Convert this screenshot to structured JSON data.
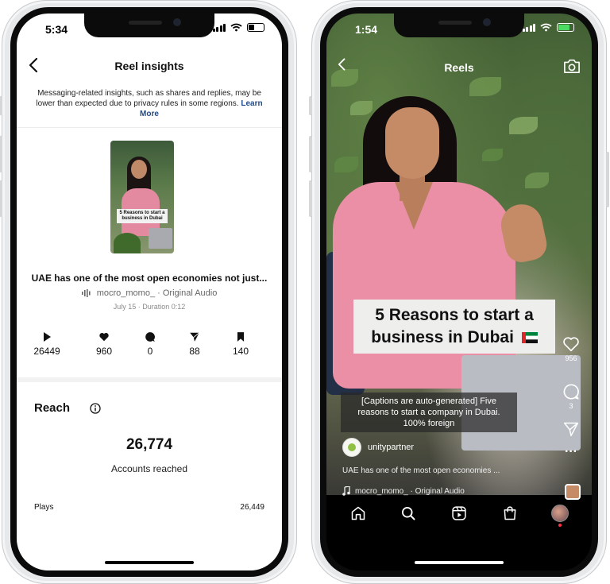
{
  "insights": {
    "status_time": "5:34",
    "header_title": "Reel insights",
    "notice_text": "Messaging-related insights, such as shares and replies, may be lower than expected due to privacy rules in some regions.",
    "notice_link": "Learn More",
    "thumbnail_caption": "5 Reasons to start a business in Dubai",
    "reel_caption": "UAE has one of the most open economies not just...",
    "audio": "mocro_momo_ · Original Audio",
    "meta": "July 15 · Duration 0:12",
    "stats": [
      {
        "icon": "play-icon",
        "value": "26449"
      },
      {
        "icon": "heart-icon",
        "value": "960"
      },
      {
        "icon": "comment-icon",
        "value": "0"
      },
      {
        "icon": "share-icon",
        "value": "88"
      },
      {
        "icon": "bookmark-icon",
        "value": "140"
      }
    ],
    "reach_title": "Reach",
    "accounts_reached_value": "26,774",
    "accounts_reached_label": "Accounts reached",
    "plays_label": "Plays",
    "plays_value": "26,449"
  },
  "reel": {
    "status_time": "1:54",
    "header_title": "Reels",
    "video_title_line1": "5 Reasons to start a",
    "video_title_line2": "business in Dubai",
    "like_count": "956",
    "comment_count": "3",
    "auto_caption": "[Captions are auto-generated] Five reasons to start a company in Dubai. 100% foreign",
    "username": "unitypartner",
    "caption": "UAE has one of the most open economies ...",
    "audio": "mocro_momo_ · Original Audio",
    "nav": [
      "home-icon",
      "search-icon",
      "reels-icon",
      "shop-icon",
      "profile-avatar"
    ]
  },
  "colors": {
    "accent_link": "#1f4a8a",
    "battery_green": "#4cd964",
    "notification_red": "#ff3040",
    "uae_red": "#e0262b",
    "uae_green": "#00843d"
  }
}
